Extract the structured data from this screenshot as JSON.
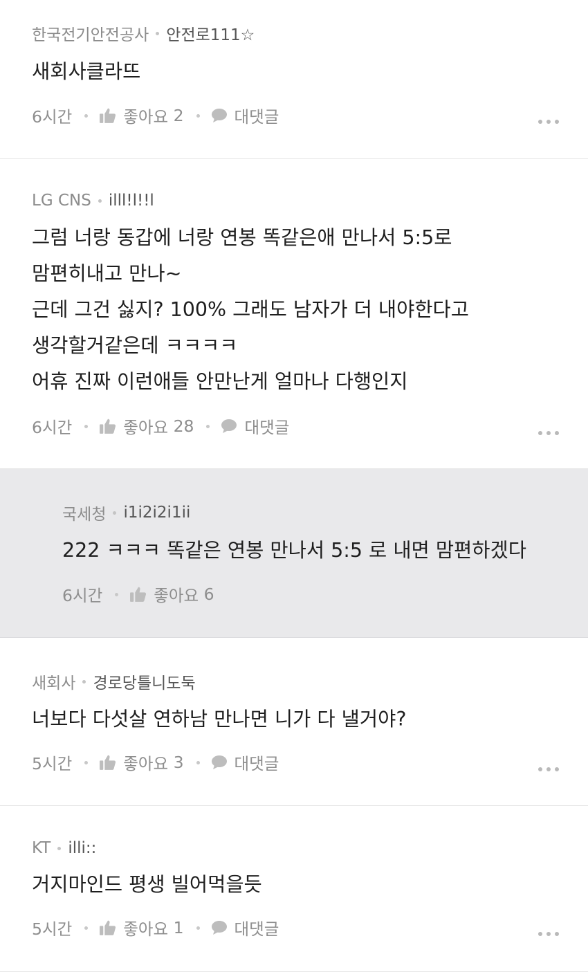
{
  "comments": [
    {
      "company": "한국전기안전공사",
      "nickname": "안전로111☆",
      "lines": [
        "새회사클라뜨"
      ],
      "time": "6시간",
      "like_label": "좋아요",
      "like_count": "2",
      "reply_label": "대댓글"
    },
    {
      "company": "LG CNS",
      "nickname": "illl!l!!l",
      "lines": [
        "그럼 너랑 동갑에 너랑 연봉 똑같은애 만나서 5:5로",
        "맘편히내고 만나~",
        "근데 그건 싫지? 100% 그래도 남자가 더 내야한다고",
        "생각할거같은데 ㅋㅋㅋㅋ",
        "어휴 진짜 이런애들 안만난게 얼마나 다행인지"
      ],
      "time": "6시간",
      "like_label": "좋아요",
      "like_count": "28",
      "reply_label": "대댓글"
    },
    {
      "company": "국세청",
      "nickname": "i1i2i2i1ii",
      "lines": [
        "222 ㅋㅋㅋ 똑같은 연봉 만나서 5:5 로 내면 맘편하겠다"
      ],
      "time": "6시간",
      "like_label": "좋아요",
      "like_count": "6"
    },
    {
      "company": "새회사",
      "nickname": "경로당틀니도둑",
      "lines": [
        "너보다 다섯살 연하남 만나면 니가 다 낼거야?"
      ],
      "time": "5시간",
      "like_label": "좋아요",
      "like_count": "3",
      "reply_label": "대댓글"
    },
    {
      "company": "KT",
      "nickname": "illi::",
      "lines": [
        "거지마인드 평생 빌어먹을듯"
      ],
      "time": "5시간",
      "like_label": "좋아요",
      "like_count": "1",
      "reply_label": "대댓글"
    }
  ]
}
